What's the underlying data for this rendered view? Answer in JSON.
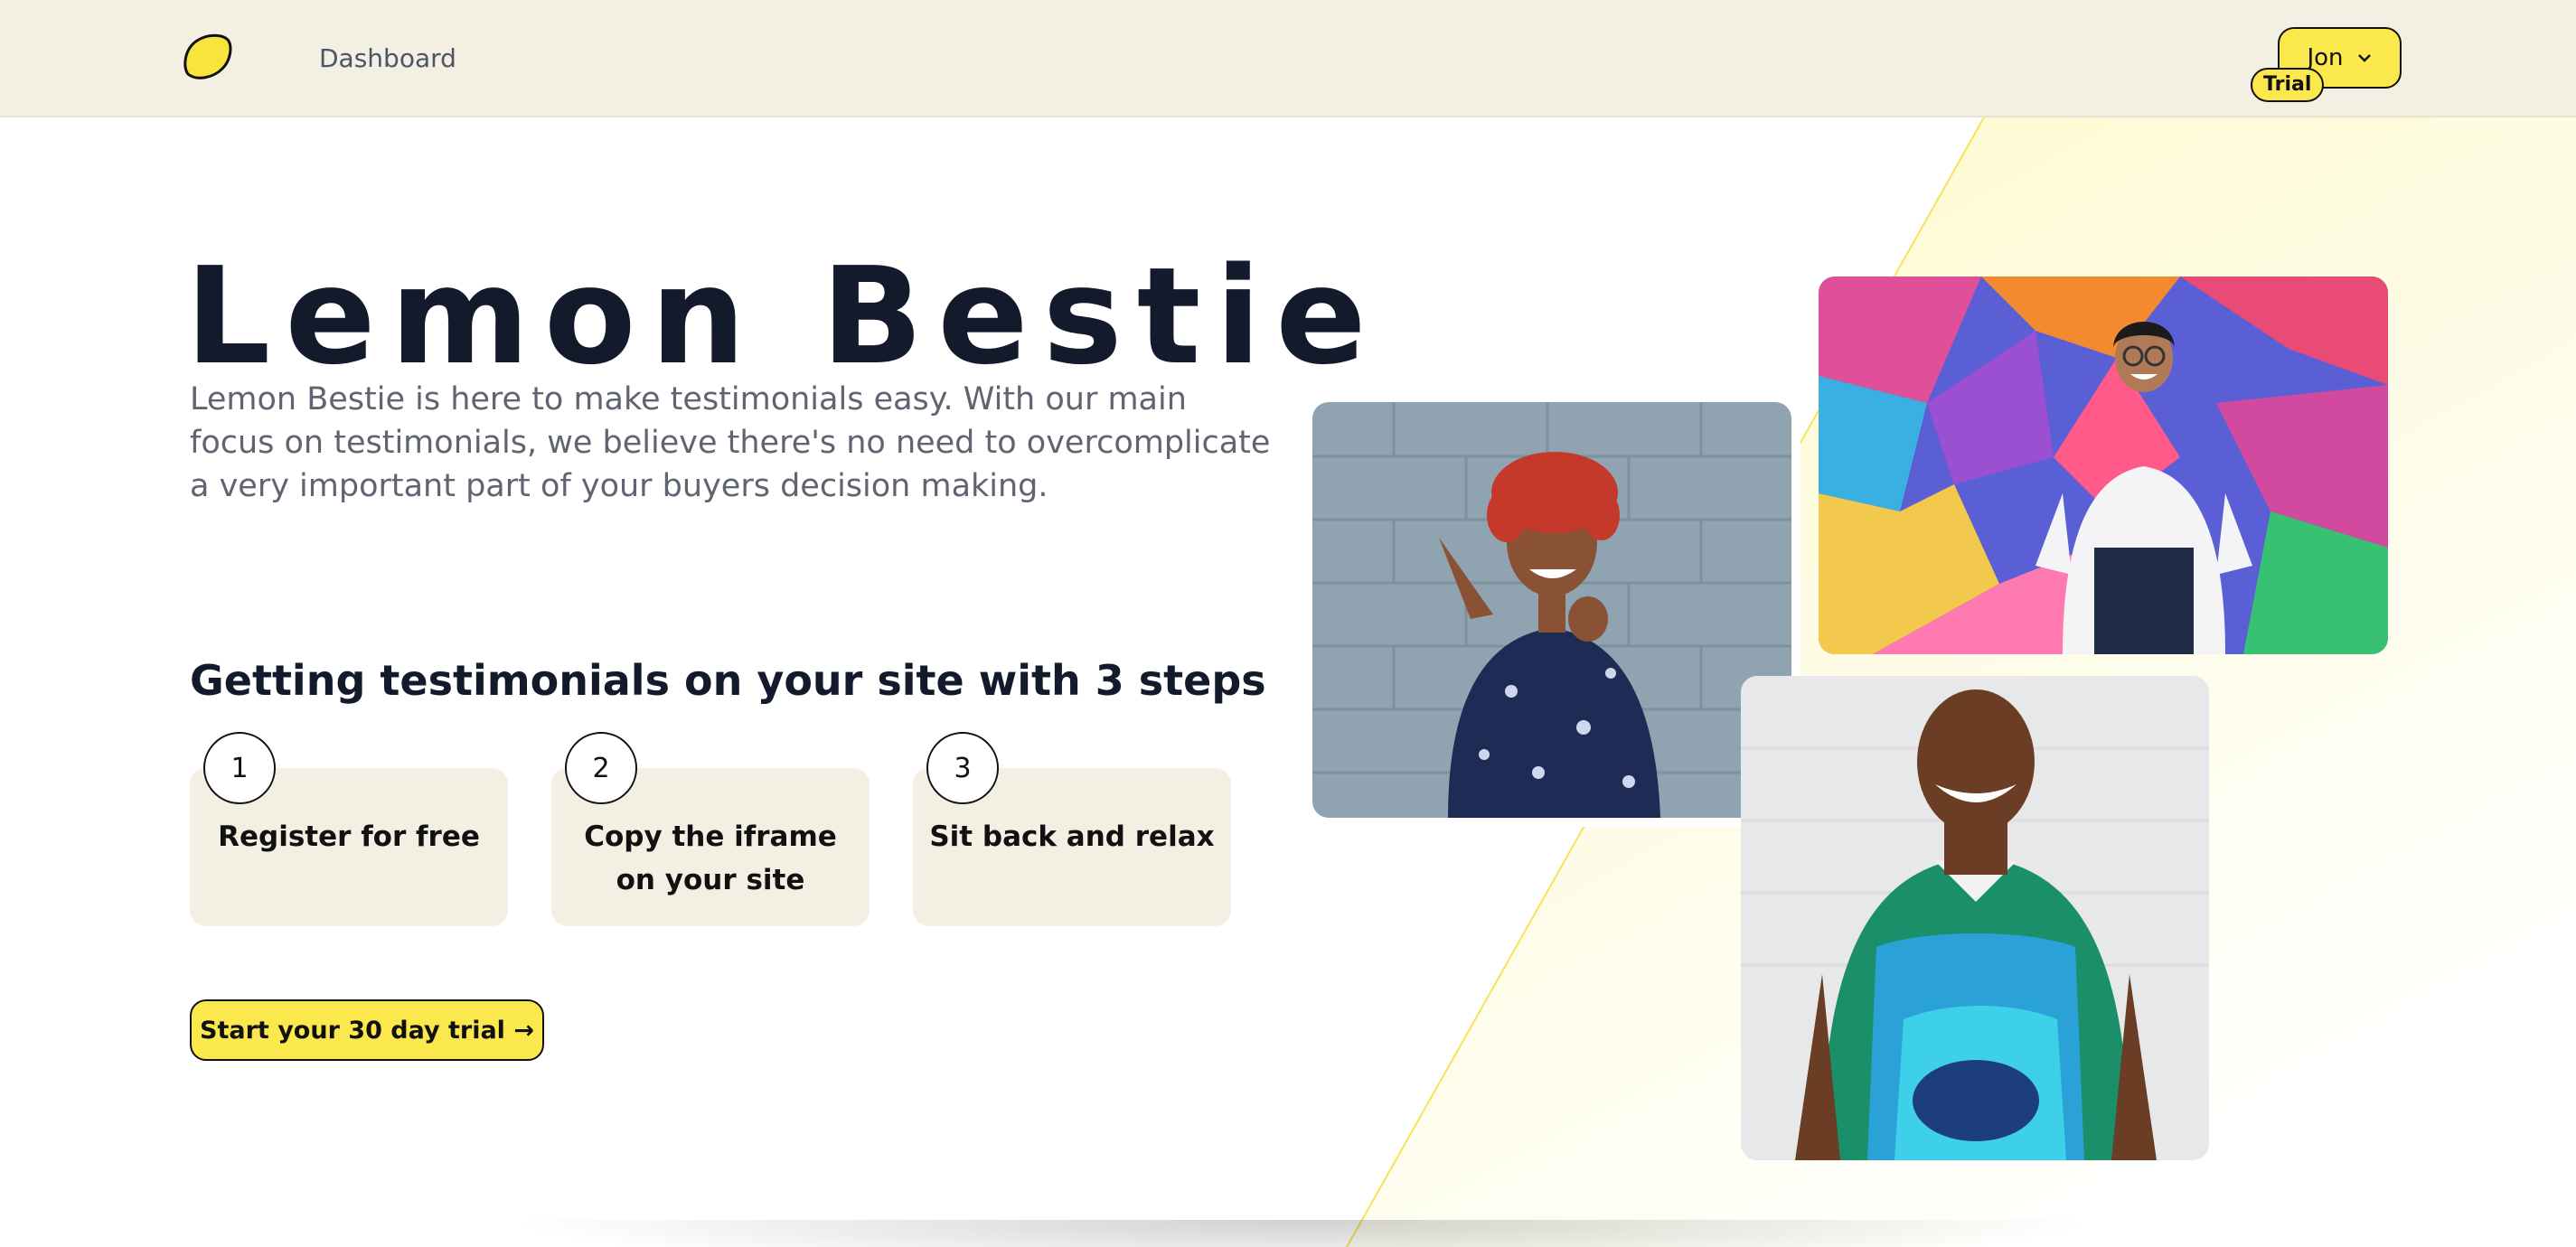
{
  "header": {
    "logo_icon": "lemon-icon",
    "nav_dashboard": "Dashboard",
    "user_name": "Jon",
    "user_chevron_icon": "chevron-down-icon",
    "trial_badge": "Trial"
  },
  "hero": {
    "title": "Lemon Bestie",
    "description": "Lemon Bestie is here to make testimonials easy. With our main focus on testimonials, we believe there's no need to overcomplicate a very important part of your buyers decision making."
  },
  "steps": {
    "heading": "Getting testimonials on your site with 3 steps",
    "items": [
      {
        "number": "1",
        "label": "Register for free"
      },
      {
        "number": "2",
        "label": "Copy the iframe on your site"
      },
      {
        "number": "3",
        "label": "Sit back and relax"
      }
    ]
  },
  "cta": {
    "label": "Start your 30 day trial →"
  },
  "colors": {
    "accent": "#fbe84c",
    "header_bg": "#f3efe3",
    "step_bg": "#f3efe3",
    "title": "#121a2b",
    "muted_text": "#5f6470"
  }
}
